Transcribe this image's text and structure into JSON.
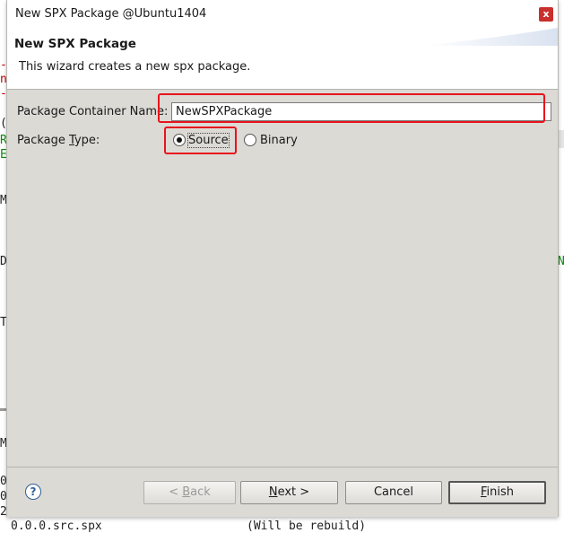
{
  "window": {
    "title": "New SPX Package @Ubuntu1404",
    "close_glyph": "x"
  },
  "banner": {
    "title": "New SPX Package",
    "description": "This wizard creates a new spx package."
  },
  "form": {
    "container_label_pre": "Package Container Name",
    "container_label_post": ":",
    "container_value": "NewSPXPackage",
    "type_label_pre": "Package ",
    "type_label_mnemonic": "T",
    "type_label_post": "ype:",
    "type_options": [
      {
        "label": "Source",
        "selected": true
      },
      {
        "label": "Binary",
        "selected": false
      }
    ]
  },
  "footer": {
    "help_glyph": "?",
    "back": {
      "pre": "< ",
      "mnemonic": "B",
      "post": "ack",
      "enabled": false
    },
    "next": {
      "mnemonic": "N",
      "post": "ext >"
    },
    "cancel": "Cancel",
    "finish": {
      "mnemonic": "F",
      "post": "inish"
    }
  },
  "background_text": {
    "left_chars": [
      "-",
      "n",
      "-",
      "(",
      "R",
      "E",
      "M",
      "D",
      "T",
      "M",
      "0.",
      "0.",
      "2."
    ],
    "right_chars": [
      "N"
    ],
    "bottom_left": "0.0.0.src.spx",
    "bottom_right": "(Will be rebuild)"
  },
  "colors": {
    "dialog_bg": "#dcdad5",
    "highlight": "#e8141c",
    "close_button": "#c9302c"
  }
}
